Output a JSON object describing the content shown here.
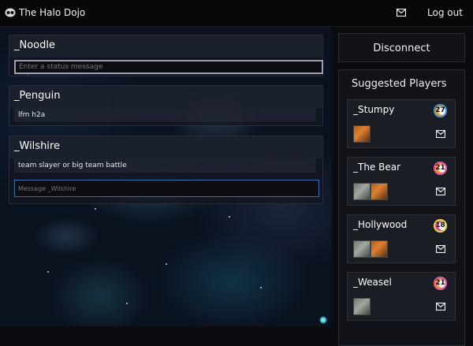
{
  "header": {
    "app_title": "The Halo Dojo",
    "logout_label": "Log out",
    "icons": [
      "logo-icon",
      "mail-icon"
    ]
  },
  "feed": {
    "self": {
      "name": "_Noodle",
      "status_placeholder": "Enter a status message"
    },
    "cards": [
      {
        "name": "_Penguin",
        "status": "lfm h2a"
      },
      {
        "name": "_Wilshire",
        "status": "team slayer or big team battle",
        "message_placeholder": "Message _Wilshire"
      }
    ]
  },
  "sidebar": {
    "disconnect_label": "Disconnect",
    "suggested_title": "Suggested Players",
    "players": [
      {
        "name": "_Stumpy",
        "level": "27",
        "level_color": "#3a8ee8",
        "thumbs": [
          "orange"
        ]
      },
      {
        "name": "_The Bear",
        "level": "21",
        "level_color": "#e84aa0",
        "thumbs": [
          "grey",
          "orange"
        ]
      },
      {
        "name": "_Hollywood",
        "level": "18",
        "level_color": "#d8e030",
        "thumbs": [
          "grey",
          "orange"
        ]
      },
      {
        "name": "_Weasel",
        "level": "21",
        "level_color": "#e84aa0",
        "thumbs": [
          "grey"
        ]
      }
    ]
  },
  "colors": {
    "accent_border": "#3a6fae",
    "panel_bg": "#111319",
    "level_gold": "#e8a020"
  }
}
